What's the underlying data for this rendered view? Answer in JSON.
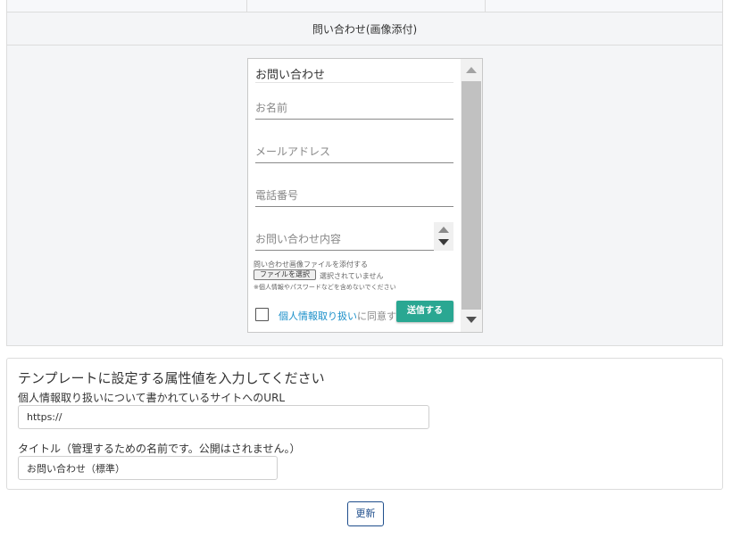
{
  "preview": {
    "header": "問い合わせ(画像添付)"
  },
  "form": {
    "title": "お問い合わせ",
    "name_placeholder": "お名前",
    "email_placeholder": "メールアドレス",
    "tel_placeholder": "電話番号",
    "message_placeholder": "お問い合わせ内容",
    "attach_label": "問い合わせ画像ファイルを添付する",
    "file_button": "ファイルを選択",
    "file_status": "選択されていません",
    "note": "※個人情報やパスワードなどを含めないでください",
    "agree_link": "個人情報取り扱い",
    "agree_suffix": "に同意する",
    "submit_label": "送信する"
  },
  "attributes": {
    "title": "テンプレートに設定する属性値を入力してください",
    "url_label": "個人情報取り扱いについて書かれているサイトへのURL",
    "url_value": "https://",
    "name_label": "タイトル（管理するための名前です。公開はされません。）",
    "name_value": "お問い合わせ（標準）"
  },
  "actions": {
    "update_label": "更新"
  },
  "colors": {
    "submit_bg": "#2aa792",
    "link": "#1a8fc9",
    "update_border": "#1f4e8c"
  }
}
